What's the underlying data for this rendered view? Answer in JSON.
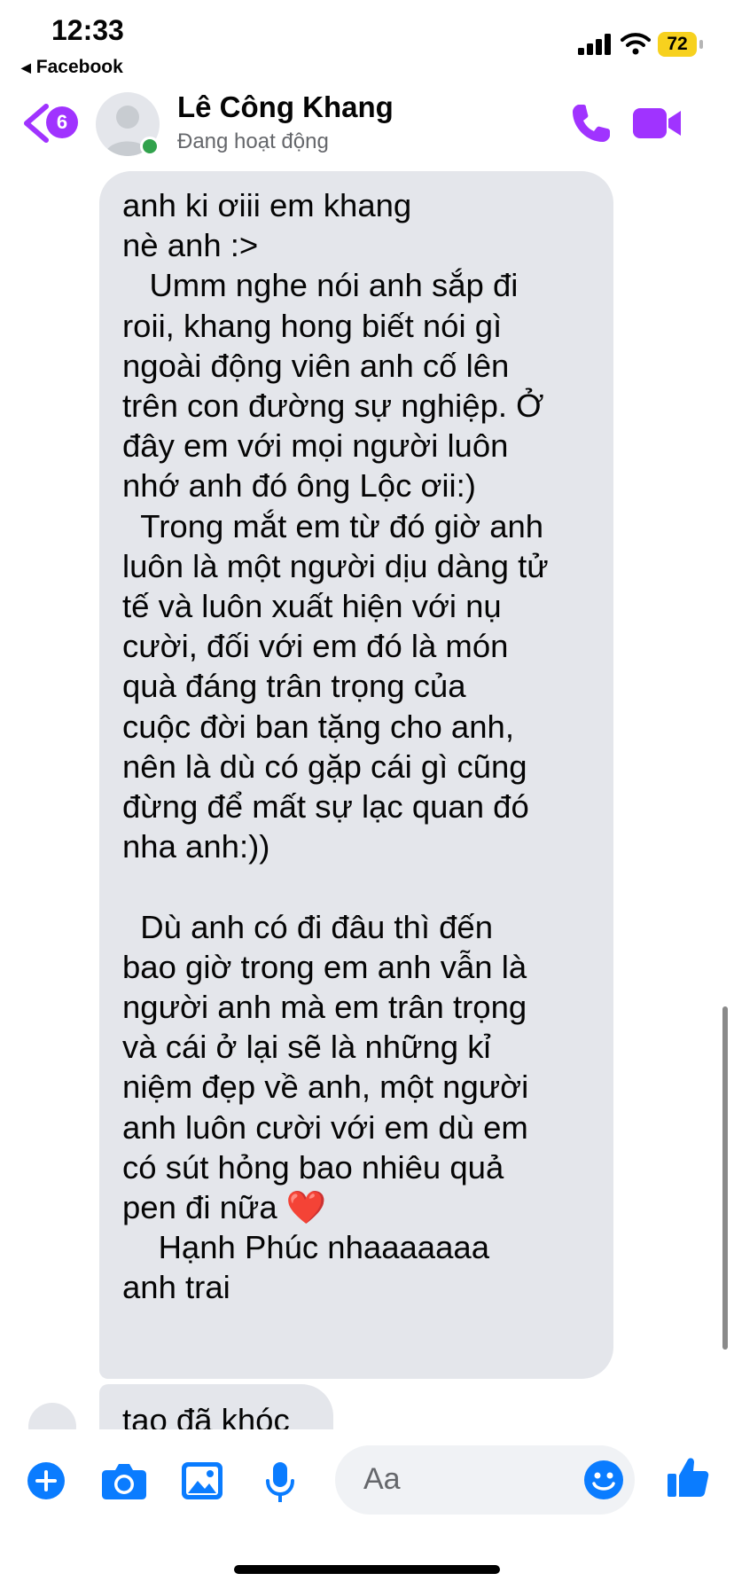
{
  "status_bar": {
    "time": "12:33",
    "back_app_label": "Facebook",
    "battery_level": "72",
    "battery_color": "#f7d11e"
  },
  "header": {
    "unread_count": "6",
    "contact_name": "Lê Công Khang",
    "contact_status": "Đang hoạt động",
    "accent_color": "#a033ff",
    "online_color": "#31a24c",
    "icons": [
      "chevron-left-icon",
      "avatar",
      "phone-icon",
      "video-camera-icon"
    ]
  },
  "messages": [
    {
      "sender": "incoming",
      "text": "anh ki ơiii em khang\nnè anh :>\n   Umm nghe nói anh sắp đi\nroii, khang hong biết nói gì\nngoài động viên anh cố lên\ntrên con đường sự nghiệp. Ở\nđây em với mọi người luôn\nnhớ anh đó ông Lộc ơii:)\n  Trong mắt em từ đó giờ anh\nluôn là một người dịu dàng tử\ntế và luôn xuất hiện với nụ\ncười, đối với em đó là món\nquà đáng trân trọng của\ncuộc đời ban tặng cho anh,\nnên là dù có gặp cái gì cũng\nđừng để mất sự lạc quan đó\nnha anh:))\n\n  Dù anh có đi đâu thì đến\nbao giờ trong em anh vẫn là\nngười anh mà em trân trọng\nvà cái ở lại sẽ là những kỉ\nniệm đẹp về anh, một người\nanh luôn cười với em dù em\ncó sút hỏng bao nhiêu quả\npen đi nữa ❤️\n    Hạnh Phúc nhaaaaaaa\nanh trai"
    },
    {
      "sender": "incoming",
      "text": "tao đã khóc"
    }
  ],
  "composer": {
    "placeholder": "Aa",
    "icon_color": "#0a7cff",
    "icons": [
      "plus-circle-icon",
      "camera-icon",
      "gallery-icon",
      "microphone-icon",
      "emoji-icon",
      "thumbs-up-icon"
    ]
  }
}
